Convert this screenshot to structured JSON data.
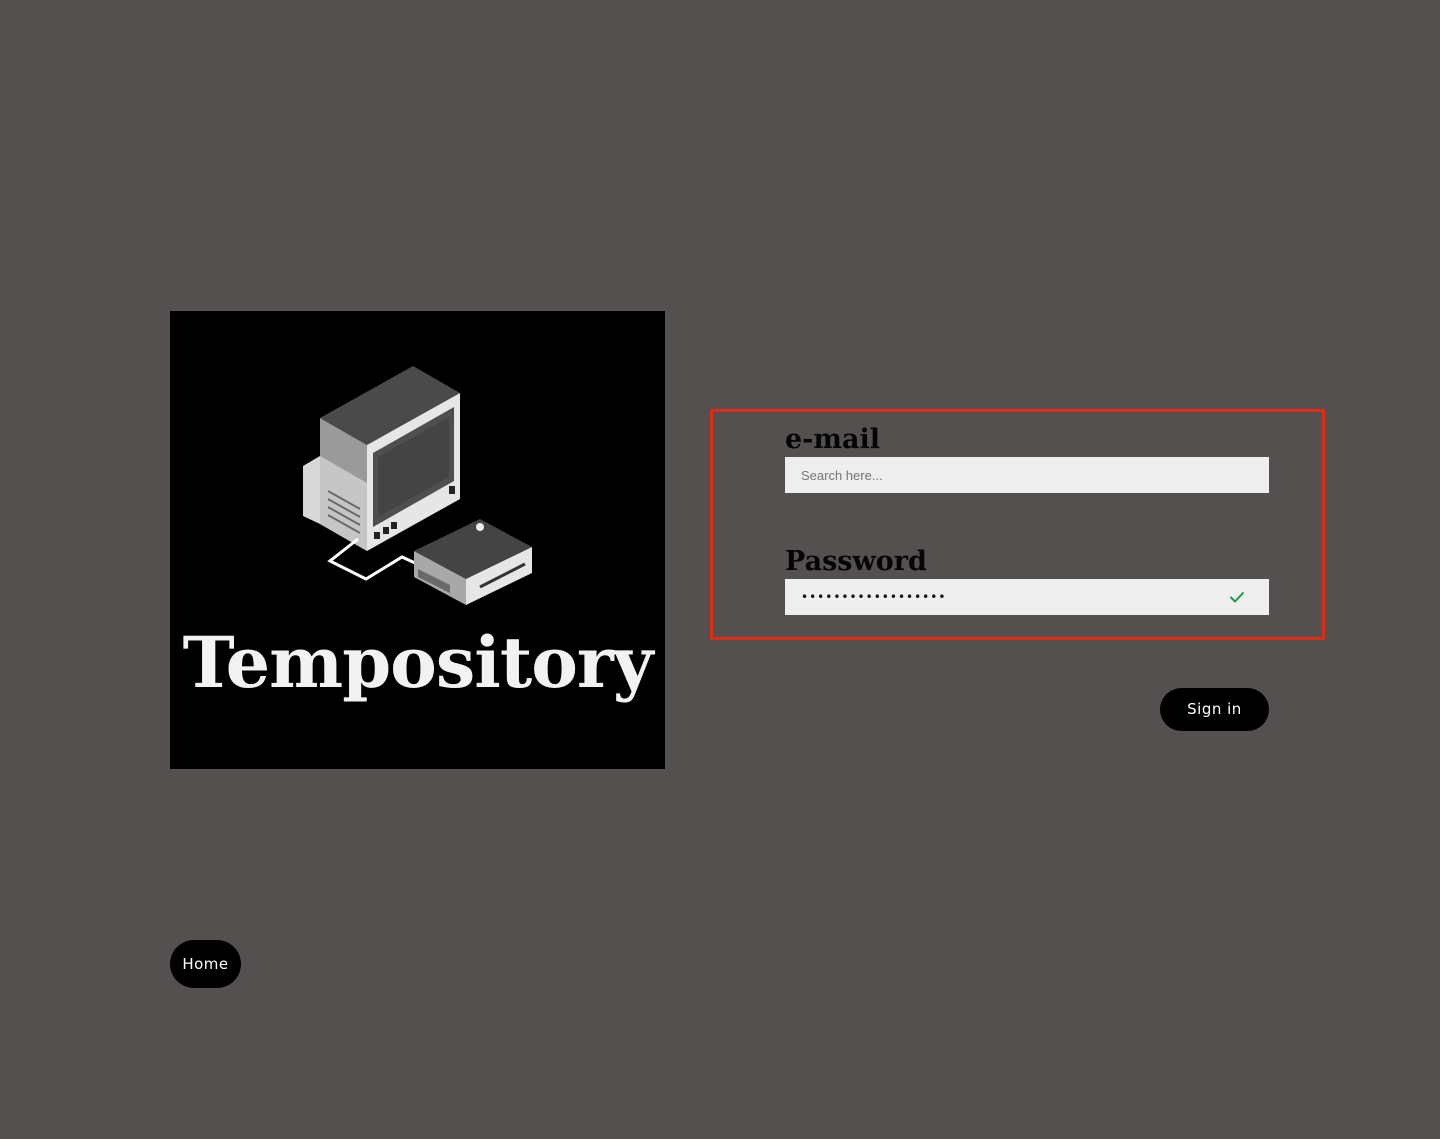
{
  "brand": {
    "name": "Tempository",
    "logo_icon": "retro-computer-icon"
  },
  "form": {
    "email": {
      "label": "e-mail",
      "placeholder": "Search here...",
      "value": ""
    },
    "password": {
      "label": "Password",
      "masked_value": "••••••••••••••••••",
      "status_icon": "check-icon",
      "status_color": "#1a9a4a"
    },
    "highlight_color": "#e02c17"
  },
  "buttons": {
    "signin_label": "Sign in",
    "home_label": "Home"
  },
  "colors": {
    "background": "#54504f",
    "button_bg": "#000000",
    "field_bg": "#eeeeee"
  }
}
